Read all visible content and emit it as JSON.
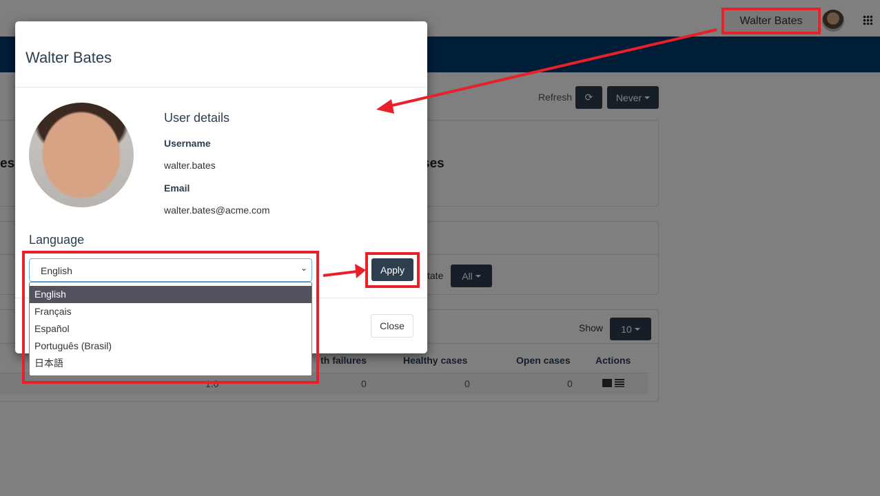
{
  "header": {
    "user_name": "Walter Bates",
    "apps_icon": "grid-icon"
  },
  "toolbar": {
    "refresh_label": "Refresh",
    "refresh_icon": "refresh-icon",
    "auto_refresh": "Never"
  },
  "background": {
    "summary_fragment_left": "es",
    "summary_fragment_right": "ses",
    "filter_state_fragment": "tate",
    "filter_state_value": "All",
    "show_label": "Show",
    "show_value": "10",
    "columns": [
      "th failures",
      "Healthy cases",
      "Open cases",
      "Actions"
    ],
    "row": {
      "version": "1.0",
      "failures": "0",
      "healthy": "0",
      "open": "0"
    }
  },
  "modal": {
    "title": "Walter Bates",
    "section_title": "User details",
    "username_label": "Username",
    "username": "walter.bates",
    "email_label": "Email",
    "email": "walter.bates@acme.com",
    "language_label": "Language",
    "language_value": "English",
    "language_options": [
      "English",
      "Français",
      "Español",
      "Português (Brasil)",
      "日本語"
    ],
    "apply_label": "Apply",
    "close_label": "Close"
  },
  "colors": {
    "navbar": "#003a70",
    "button": "#2c3e50",
    "annotation": "#e8202a"
  }
}
